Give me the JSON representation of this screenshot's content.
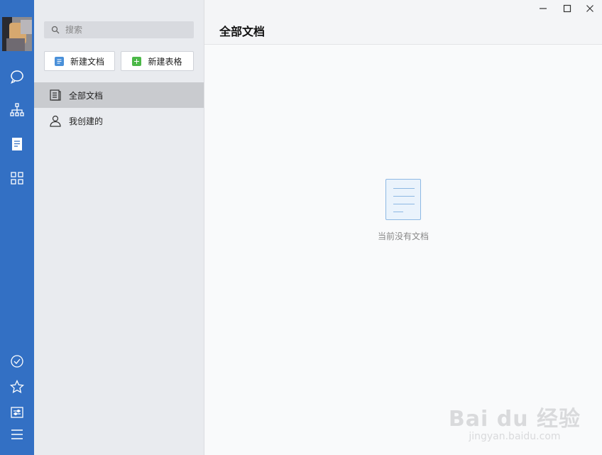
{
  "sidebar": {
    "search_placeholder": "搜索",
    "new_doc_label": "新建文档",
    "new_sheet_label": "新建表格",
    "items": [
      {
        "label": "全部文档",
        "icon": "documents-icon",
        "active": true
      },
      {
        "label": "我创建的",
        "icon": "person-icon",
        "active": false
      }
    ]
  },
  "rail": {
    "icons": [
      "chat-icon",
      "org-chart-icon",
      "document-icon",
      "apps-grid-icon",
      "check-circle-icon",
      "star-icon",
      "settings-panel-icon",
      "menu-icon"
    ],
    "accent": "#3370c4"
  },
  "main": {
    "title": "全部文档",
    "empty_text": "当前没有文档"
  },
  "window": {
    "controls": [
      "minimize-icon",
      "maximize-icon",
      "close-icon"
    ]
  },
  "watermark": {
    "line1": "Bai du 经验",
    "line2": "jingyan.baidu.com"
  }
}
